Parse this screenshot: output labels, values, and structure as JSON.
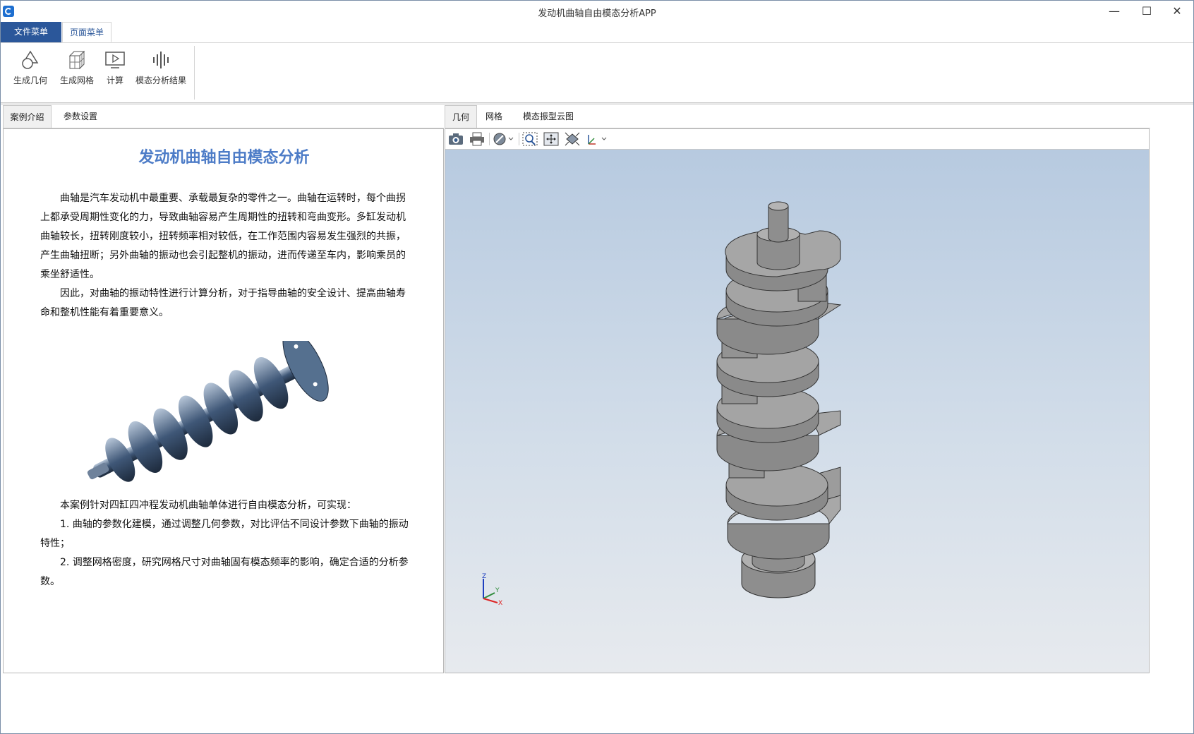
{
  "window": {
    "title": "发动机曲轴自由模态分析APP"
  },
  "window_controls": {
    "minimize": "—",
    "maximize": "☐",
    "close": "✕"
  },
  "menu": {
    "file": "文件菜单",
    "page": "页面菜单"
  },
  "ribbon": {
    "geometry": "生成几何",
    "mesh": "生成网格",
    "compute": "计算",
    "results": "模态分析结果"
  },
  "left_tabs": {
    "intro": "案例介绍",
    "params": "参数设置"
  },
  "right_tabs": {
    "geometry": "几何",
    "mesh": "网格",
    "mode_plot": "模态振型云图"
  },
  "intro": {
    "title": "发动机曲轴自由模态分析",
    "p1": "曲轴是汽车发动机中最重要、承载最复杂的零件之一。曲轴在运转时，每个曲拐上都承受周期性变化的力，导致曲轴容易产生周期性的扭转和弯曲变形。多缸发动机曲轴较长，扭转刚度较小，扭转频率相对较低，在工作范围内容易发生强烈的共振，产生曲轴扭断；另外曲轴的振动也会引起整机的振动，进而传递至车内，影响乘员的乘坐舒适性。",
    "p2": "因此，对曲轴的振动特性进行计算分析，对于指导曲轴的安全设计、提高曲轴寿命和整机性能有着重要意义。",
    "p3": "本案例针对四缸四冲程发动机曲轴单体进行自由模态分析，可实现：",
    "p4": "1. 曲轴的参数化建模，通过调整几何参数，对比评估不同设计参数下曲轴的振动特性；",
    "p5": "2. 调整网格密度，研究网格尺寸对曲轴固有模态频率的影响，确定合适的分析参数。"
  },
  "axes": {
    "z": "Z",
    "y": "Y",
    "x": "X"
  },
  "colors": {
    "accent": "#2b579a",
    "title": "#4d7cc7",
    "model": "#9a9a9a"
  }
}
